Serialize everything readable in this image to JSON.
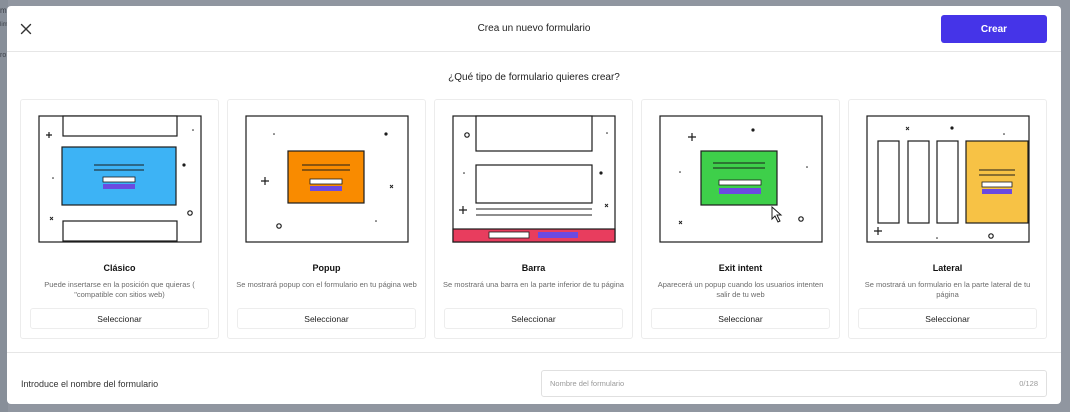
{
  "modal": {
    "title": "Crea un nuevo formulario",
    "create_label": "Crear",
    "question": "¿Qué tipo de formulario quieres crear?"
  },
  "cards": [
    {
      "title": "Clásico",
      "description": "Puede insertarse en la posición que quieras ( \"compatible con sitios web)",
      "select_label": "Seleccionar",
      "accent": "#3db3f5"
    },
    {
      "title": "Popup",
      "description": "Se mostrará popup con el formulario en tu página web",
      "select_label": "Seleccionar",
      "accent": "#f98b00"
    },
    {
      "title": "Barra",
      "description": "Se mostrará una barra en la parte inferior de tu página",
      "select_label": "Seleccionar",
      "accent": "#e83d5e"
    },
    {
      "title": "Exit intent",
      "description": "Aparecerá un popup cuando los usuarios intenten salir de tu web",
      "select_label": "Seleccionar",
      "accent": "#3ecf4a"
    },
    {
      "title": "Lateral",
      "description": "Se mostrará un formulario en la parte lateral de tu página",
      "select_label": "Seleccionar",
      "accent": "#f7c245"
    }
  ],
  "footer": {
    "label": "Introduce el nombre del formulario",
    "placeholder": "Nombre del formulario",
    "char_count": "0/128"
  },
  "background": {
    "fragments": [
      "m",
      "lim",
      "ro"
    ]
  },
  "colors": {
    "primary": "#4534e8",
    "form_purple": "#6b4ae0"
  }
}
